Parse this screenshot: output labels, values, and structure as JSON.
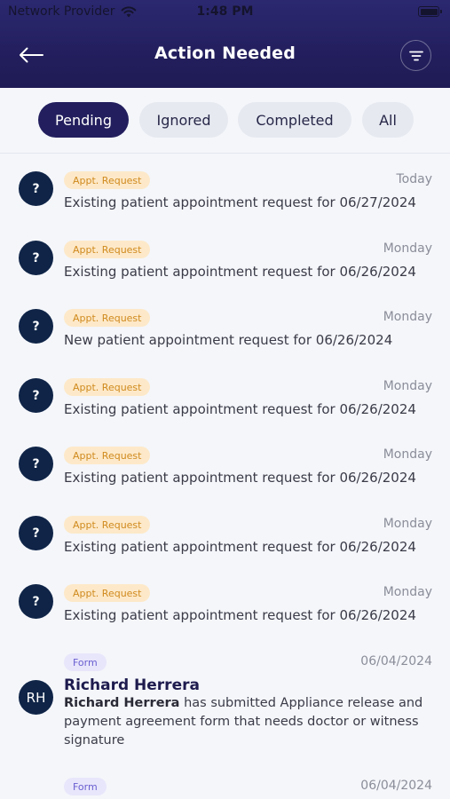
{
  "status_bar": {
    "carrier": "Network Provider",
    "time": "1:48 PM",
    "icons": [
      "wifi-icon",
      "battery-icon"
    ]
  },
  "header": {
    "back_icon": "arrow-left-icon",
    "title": "Action Needed",
    "filter_icon": "filter-lines-icon"
  },
  "tabs": [
    {
      "label": "Pending",
      "active": true
    },
    {
      "label": "Ignored",
      "active": false
    },
    {
      "label": "Completed",
      "active": false
    },
    {
      "label": "All",
      "active": false
    }
  ],
  "items": [
    {
      "badge": "Appt. Request",
      "date": "Today",
      "avatar": "?",
      "text": "Existing patient appointment request for 06/27/2024"
    },
    {
      "badge": "Appt. Request",
      "date": "Monday",
      "avatar": "?",
      "text": "Existing patient appointment request for 06/26/2024"
    },
    {
      "badge": "Appt. Request",
      "date": "Monday",
      "avatar": "?",
      "text": "New patient appointment request for 06/26/2024"
    },
    {
      "badge": "Appt. Request",
      "date": "Monday",
      "avatar": "?",
      "text": "Existing patient appointment request for 06/26/2024"
    },
    {
      "badge": "Appt. Request",
      "date": "Monday",
      "avatar": "?",
      "text": "Existing patient appointment request for 06/26/2024"
    },
    {
      "badge": "Appt. Request",
      "date": "Monday",
      "avatar": "?",
      "text": "Existing patient appointment request for 06/26/2024"
    },
    {
      "badge": "Appt. Request",
      "date": "Monday",
      "avatar": "?",
      "text": "Existing patient appointment request for 06/26/2024"
    }
  ],
  "form_items": [
    {
      "badge": "Form",
      "date": "06/04/2024",
      "avatar": "RH",
      "name": "Richard Herrera",
      "desc_name": "Richard Herrera",
      "desc_rest": " has submitted Appliance release and payment agreement form that needs doctor or witness signature"
    },
    {
      "badge": "Form",
      "date": "06/04/2024"
    }
  ],
  "colors": {
    "header": "#231f5e",
    "avatar": "#0f2447",
    "appt_badge_bg": "#fde9c9",
    "appt_badge_text": "#d08a1e",
    "form_badge_bg": "#e8e6fb",
    "form_badge_text": "#6a5fd0"
  }
}
